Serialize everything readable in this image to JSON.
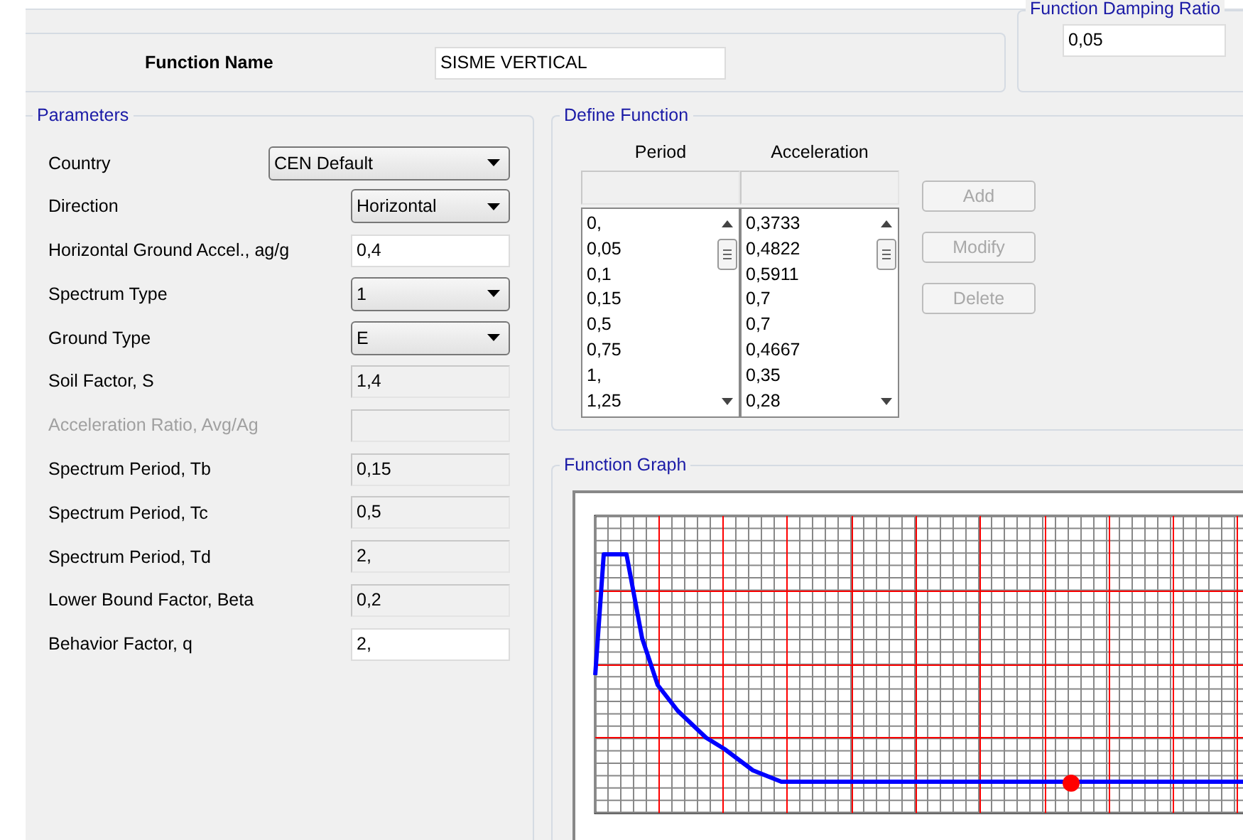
{
  "function_name": {
    "label": "Function Name",
    "value": "SISME VERTICAL"
  },
  "damping": {
    "title": "Function Damping Ratio",
    "value": "0,05"
  },
  "parameters": {
    "title": "Parameters",
    "rows": [
      {
        "label": "Country",
        "kind": "dropdown",
        "value": "CEN Default",
        "disabled": false
      },
      {
        "label": "Direction",
        "kind": "dropdown",
        "value": "Horizontal",
        "disabled": false
      },
      {
        "label": "Horizontal Ground Accel.,  ag/g",
        "kind": "input",
        "value": "0,4",
        "disabled": false
      },
      {
        "label": "Spectrum Type",
        "kind": "dropdown",
        "value": "1",
        "disabled": false
      },
      {
        "label": "Ground Type",
        "kind": "dropdown",
        "value": "E",
        "disabled": false
      },
      {
        "label": "Soil Factor, S",
        "kind": "readonly",
        "value": "1,4",
        "disabled": false
      },
      {
        "label": "Acceleration Ratio,  Avg/Ag",
        "kind": "readonly",
        "disabled": true
      },
      {
        "label": "Spectrum Period, Tb",
        "kind": "readonly",
        "value": "0,15",
        "disabled": false
      },
      {
        "label": "Spectrum Period, Tc",
        "kind": "readonly",
        "value": "0,5",
        "disabled": false
      },
      {
        "label": "Spectrum Period, Td",
        "kind": "readonly",
        "value": "2,",
        "disabled": false
      },
      {
        "label": "Lower Bound Factor, Beta",
        "kind": "readonly",
        "value": "0,2",
        "disabled": false
      },
      {
        "label": "Behavior Factor, q",
        "kind": "input",
        "value": "2,",
        "disabled": false
      }
    ]
  },
  "define_function": {
    "title": "Define Function",
    "columns": [
      {
        "header": "Period",
        "values": [
          "0,",
          "0,05",
          "0,1",
          "0,15",
          "0,5",
          "0,75",
          "1,",
          "1,25"
        ]
      },
      {
        "header": "Acceleration",
        "values": [
          "0,3733",
          "0,4822",
          "0,5911",
          "0,7",
          "0,7",
          "0,4667",
          "0,35",
          "0,28"
        ]
      }
    ],
    "buttons": [
      {
        "label": "Add",
        "disabled": true
      },
      {
        "label": "Modify",
        "disabled": true
      },
      {
        "label": "Delete",
        "disabled": true
      }
    ]
  },
  "function_graph": {
    "title": "Function Graph"
  }
}
